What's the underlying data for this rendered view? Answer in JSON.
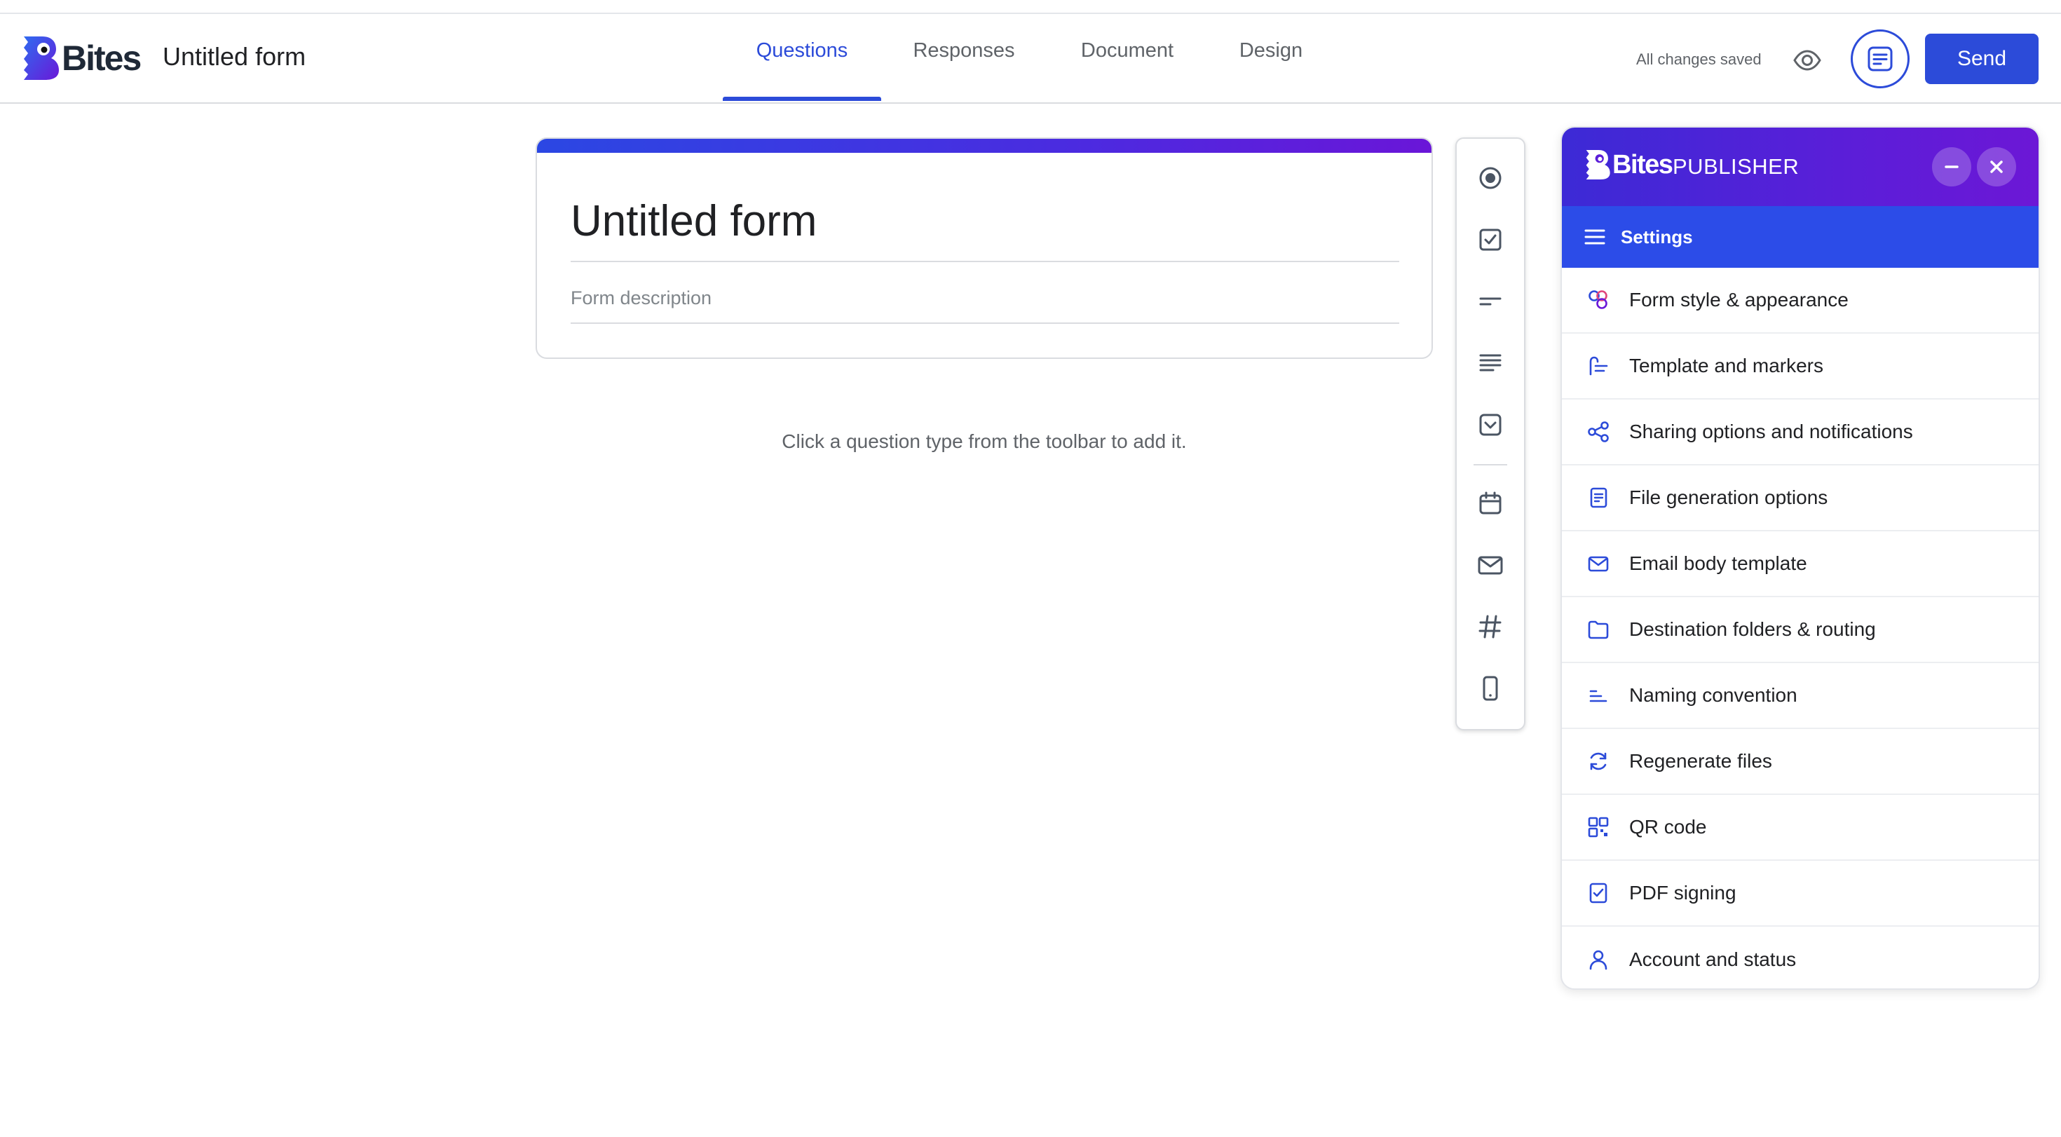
{
  "app": {
    "brand": "Bites",
    "form_title": "Untitled form",
    "save_status": "All changes saved",
    "send_label": "Send"
  },
  "tabs": [
    {
      "label": "Questions",
      "active": true
    },
    {
      "label": "Responses",
      "active": false
    },
    {
      "label": "Document",
      "active": false
    },
    {
      "label": "Design",
      "active": false
    }
  ],
  "form": {
    "title": "Untitled form",
    "description_placeholder": "Form description",
    "empty_hint": "Click a question type from the toolbar to add it."
  },
  "toolbar": {
    "tools": [
      {
        "icon": "radio-button-icon"
      },
      {
        "icon": "checkbox-icon"
      },
      {
        "icon": "short-answer-icon"
      },
      {
        "icon": "paragraph-icon"
      },
      {
        "icon": "dropdown-icon"
      },
      {
        "icon": "calendar-icon"
      },
      {
        "icon": "email-icon"
      },
      {
        "icon": "number-hash-icon"
      },
      {
        "icon": "phone-icon"
      }
    ]
  },
  "publisher": {
    "brand": "Bites",
    "name": "PUBLISHER",
    "settings_label": "Settings",
    "items": [
      {
        "label": "Form style & appearance",
        "icon": "style-icon"
      },
      {
        "label": "Template and markers",
        "icon": "template-icon"
      },
      {
        "label": "Sharing options and notifications",
        "icon": "share-icon"
      },
      {
        "label": "File generation options",
        "icon": "file-icon"
      },
      {
        "label": "Email body template",
        "icon": "email-icon"
      },
      {
        "label": "Destination folders & routing",
        "icon": "folder-icon"
      },
      {
        "label": "Naming convention",
        "icon": "naming-icon"
      },
      {
        "label": "Regenerate files",
        "icon": "refresh-icon"
      },
      {
        "label": "QR code",
        "icon": "qr-code-icon"
      },
      {
        "label": "PDF signing",
        "icon": "pdf-sign-icon"
      },
      {
        "label": "Account and status",
        "icon": "account-icon"
      }
    ]
  },
  "colors": {
    "accent": "#2c4bd9",
    "panel_header": "#5b1ed8",
    "settings_bar": "#2c4ce8"
  }
}
